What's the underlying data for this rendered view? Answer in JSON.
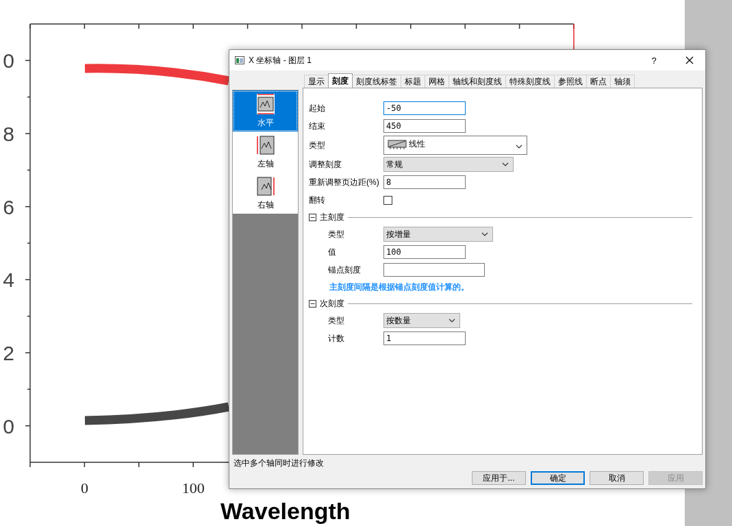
{
  "chart": {
    "y_tick_labels": [
      "0",
      "8",
      "6",
      "4",
      "2",
      "0"
    ],
    "x_tick_labels": [
      "0",
      "100"
    ],
    "x_axis_title": "Wavelength"
  },
  "dialog": {
    "title": "X 坐标轴 - 图层 1",
    "help_label": "?",
    "tabs": [
      {
        "label": "显示",
        "selected": false
      },
      {
        "label": "刻度",
        "selected": true
      },
      {
        "label": "刻度线标签",
        "selected": false
      },
      {
        "label": "标题",
        "selected": false
      },
      {
        "label": "网格",
        "selected": false
      },
      {
        "label": "轴线和刻度线",
        "selected": false
      },
      {
        "label": "特殊刻度线",
        "selected": false
      },
      {
        "label": "参照线",
        "selected": false
      },
      {
        "label": "断点",
        "selected": false
      },
      {
        "label": "轴须",
        "selected": false
      }
    ],
    "axes": [
      {
        "kind": "horizontal",
        "label": "水平",
        "selected": true
      },
      {
        "kind": "left",
        "label": "左轴",
        "selected": false
      },
      {
        "kind": "right",
        "label": "右轴",
        "selected": false
      }
    ],
    "form": [
      {
        "kind": "input",
        "label": "起始",
        "value": "-50",
        "focused": true
      },
      {
        "kind": "input",
        "label": "结束",
        "value": "450",
        "focused": false
      },
      {
        "kind": "combo",
        "label": "类型",
        "value": "线性"
      },
      {
        "kind": "select",
        "label": "调整刻度",
        "value": "常规"
      },
      {
        "kind": "input",
        "label": "重新调整页边距(%)",
        "value": "8",
        "focused": false
      },
      {
        "kind": "checkbox",
        "label": "翻转",
        "checked": false
      },
      {
        "kind": "section",
        "title": "主刻度",
        "expanded": true,
        "rows": [
          {
            "kind": "select",
            "label": "类型",
            "value": "按增量"
          },
          {
            "kind": "input",
            "label": "值",
            "value": "100",
            "focused": false
          },
          {
            "kind": "input",
            "label": "锚点刻度",
            "value": "",
            "focused": false
          },
          {
            "kind": "note",
            "text": "主刻度间隔是根据锚点刻度值计算的。"
          }
        ]
      },
      {
        "kind": "section",
        "title": "次刻度",
        "expanded": true,
        "rows": [
          {
            "kind": "select",
            "label": "类型",
            "value": "按数量"
          },
          {
            "kind": "input",
            "label": "计数",
            "value": "1",
            "focused": false
          }
        ]
      }
    ],
    "status": "选中多个轴同时进行修改",
    "buttons": [
      {
        "label": "应用于...",
        "default": false,
        "disabled": false
      },
      {
        "label": "确定",
        "default": true,
        "disabled": false
      },
      {
        "label": "取消",
        "default": false,
        "disabled": false
      },
      {
        "label": "应用",
        "default": false,
        "disabled": true
      }
    ]
  }
}
